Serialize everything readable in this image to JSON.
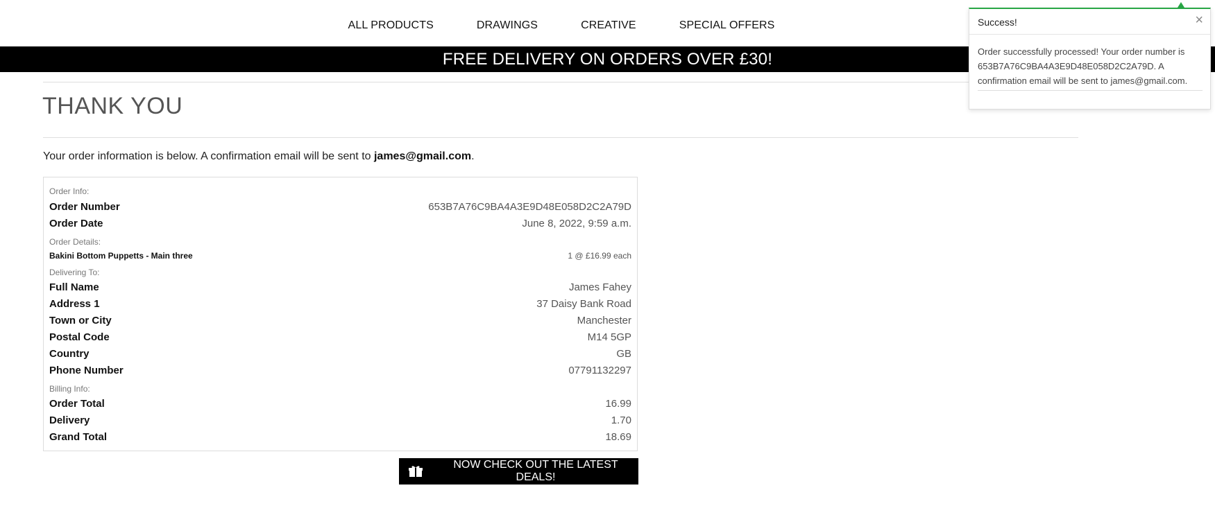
{
  "nav": {
    "items": [
      "ALL PRODUCTS",
      "DRAWINGS",
      "CREATIVE",
      "SPECIAL OFFERS"
    ]
  },
  "banner": {
    "text": "FREE DELIVERY ON ORDERS OVER £30!"
  },
  "page": {
    "title": "THANK YOU",
    "intro_prefix": "Your order information is below. A confirmation email will be sent to ",
    "intro_email": "james@gmail.com",
    "intro_suffix": "."
  },
  "order": {
    "order_info_label": "Order Info:",
    "order_number_label": "Order Number",
    "order_number": "653B7A76C9BA4A3E9D48E058D2C2A79D",
    "order_date_label": "Order Date",
    "order_date": "June 8, 2022, 9:59 a.m.",
    "order_details_label": "Order Details:",
    "item_name": "Bakini Bottom Puppetts - Main three",
    "item_qty_price": "1 @ £16.99 each",
    "delivering_to_label": "Delivering To:",
    "full_name_label": "Full Name",
    "full_name": "James Fahey",
    "address1_label": "Address 1",
    "address1": "37 Daisy Bank Road",
    "town_label": "Town or City",
    "town": "Manchester",
    "postal_label": "Postal Code",
    "postal": "M14 5GP",
    "country_label": "Country",
    "country": "GB",
    "phone_label": "Phone Number",
    "phone": "07791132297",
    "billing_label": "Billing Info:",
    "order_total_label": "Order Total",
    "order_total": "16.99",
    "delivery_label": "Delivery",
    "delivery": "1.70",
    "grand_total_label": "Grand Total",
    "grand_total": "18.69"
  },
  "deals_button": {
    "label": "NOW CHECK OUT THE LATEST DEALS!",
    "icon": "gift-icon"
  },
  "toast": {
    "title": "Success!",
    "close": "×",
    "message": "Order successfully processed! Your order number is 653B7A76C9BA4A3E9D48E058D2C2A79D. A confirmation email will be sent to james@gmail.com.",
    "accent": "#28a745"
  }
}
